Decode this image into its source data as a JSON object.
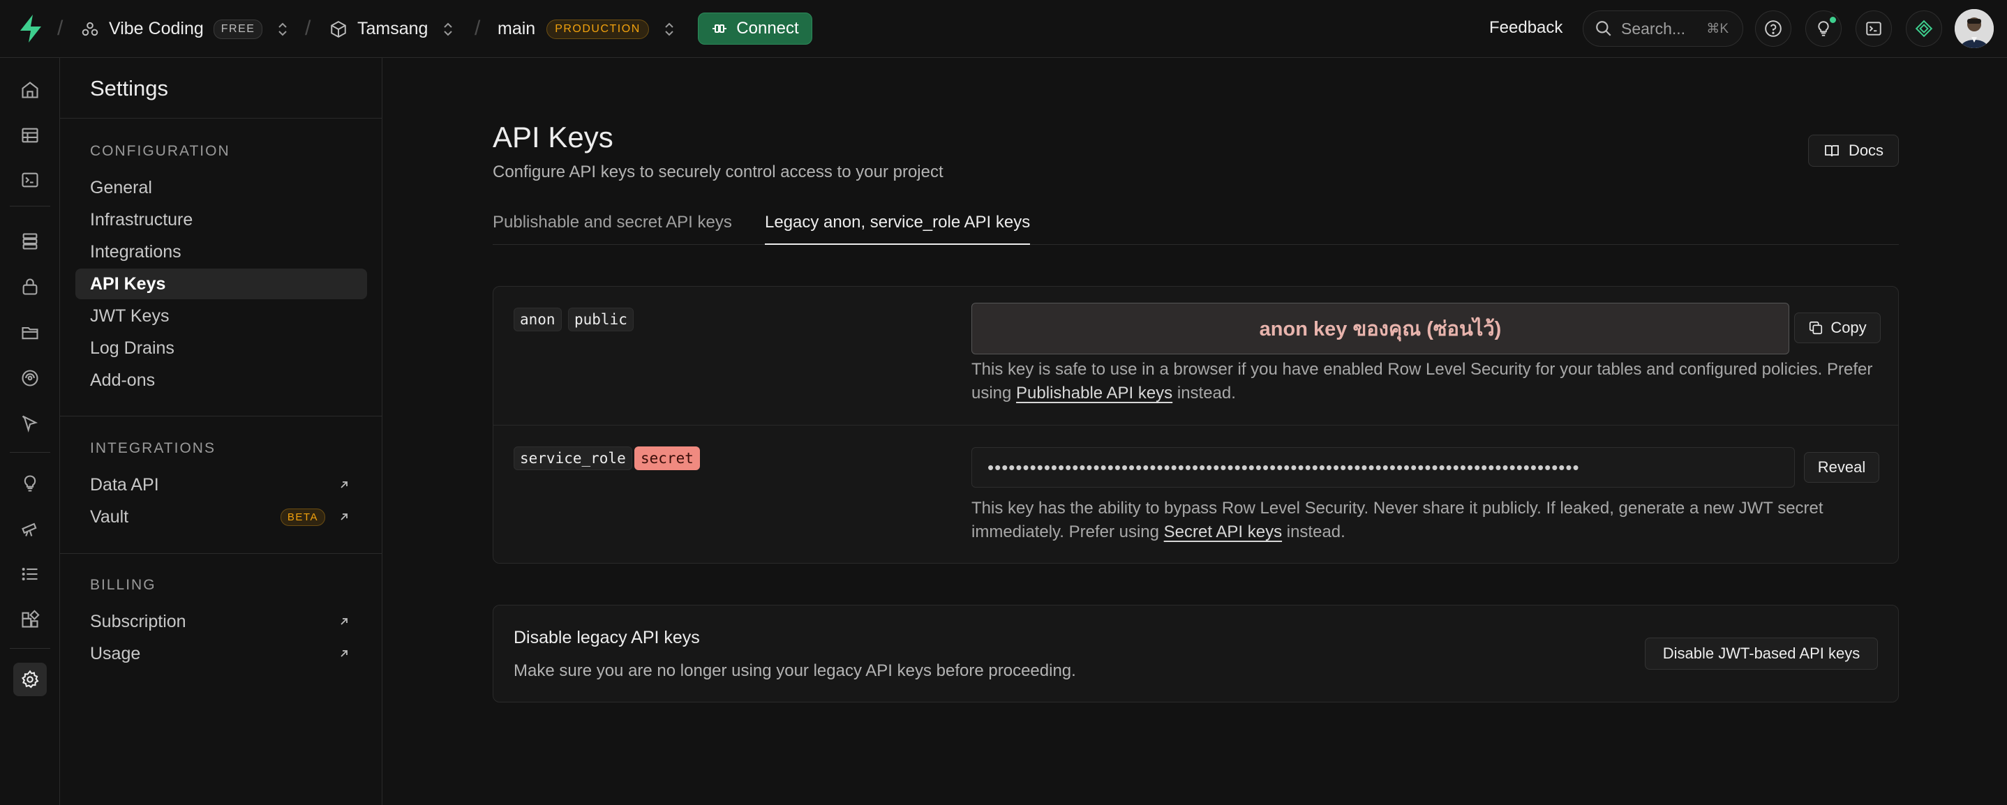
{
  "topbar": {
    "org_name": "Vibe Coding",
    "org_plan": "FREE",
    "project_name": "Tamsang",
    "branch_name": "main",
    "branch_env": "PRODUCTION",
    "connect_label": "Connect",
    "feedback_label": "Feedback",
    "search_placeholder": "Search...",
    "search_shortcut": "⌘K"
  },
  "settings": {
    "title": "Settings",
    "sections": [
      {
        "heading": "CONFIGURATION",
        "items": [
          "General",
          "Infrastructure",
          "Integrations",
          "API Keys",
          "JWT Keys",
          "Log Drains",
          "Add-ons"
        ]
      },
      {
        "heading": "INTEGRATIONS",
        "items": [
          "Data API",
          "Vault"
        ],
        "badge": "BETA"
      },
      {
        "heading": "BILLING",
        "items": [
          "Subscription",
          "Usage"
        ]
      }
    ],
    "active_item": "API Keys"
  },
  "page": {
    "title": "API Keys",
    "subtitle": "Configure API keys to securely control access to your project",
    "docs_label": "Docs",
    "tabs": [
      "Publishable and secret API keys",
      "Legacy anon, service_role API keys"
    ],
    "active_tab": "Legacy anon, service_role API keys"
  },
  "keys": {
    "anon": {
      "tag1": "anon",
      "tag2": "public",
      "value": "anon key ของคุณ (ซ่อนไว้)",
      "copy_label": "Copy",
      "desc_before": "This key is safe to use in a browser if you have enabled Row Level Security for your tables and configured policies. Prefer using ",
      "desc_link": "Publishable API keys",
      "desc_after": " instead."
    },
    "service_role": {
      "tag1": "service_role",
      "tag2": "secret",
      "masked_value": "••••••••••••••••••••••••••••••••••••••••••••••••••••••••••••••••••••••••••••••••••••",
      "reveal_label": "Reveal",
      "desc_before": "This key has the ability to bypass Row Level Security. Never share it publicly. If leaked, generate a new JWT secret immediately. Prefer using ",
      "desc_link": "Secret API keys",
      "desc_after": " instead."
    }
  },
  "disable_legacy": {
    "title": "Disable legacy API keys",
    "subtitle": "Make sure you are no longer using your legacy API keys before proceeding.",
    "button_label": "Disable JWT-based API keys"
  },
  "colors": {
    "accent_green": "#3ecf8e",
    "connect_bg": "#1f6d45",
    "production_badge": "#f1a10d",
    "secret_badge": "#f08a80"
  },
  "icons": {
    "rail": [
      "home-icon",
      "table-editor-icon",
      "sql-editor-icon",
      "database-icon",
      "auth-icon",
      "storage-icon",
      "edge-functions-icon",
      "realtime-icon",
      "advisors-icon",
      "reports-icon",
      "logs-icon",
      "integrations-icon",
      "settings-icon"
    ]
  }
}
